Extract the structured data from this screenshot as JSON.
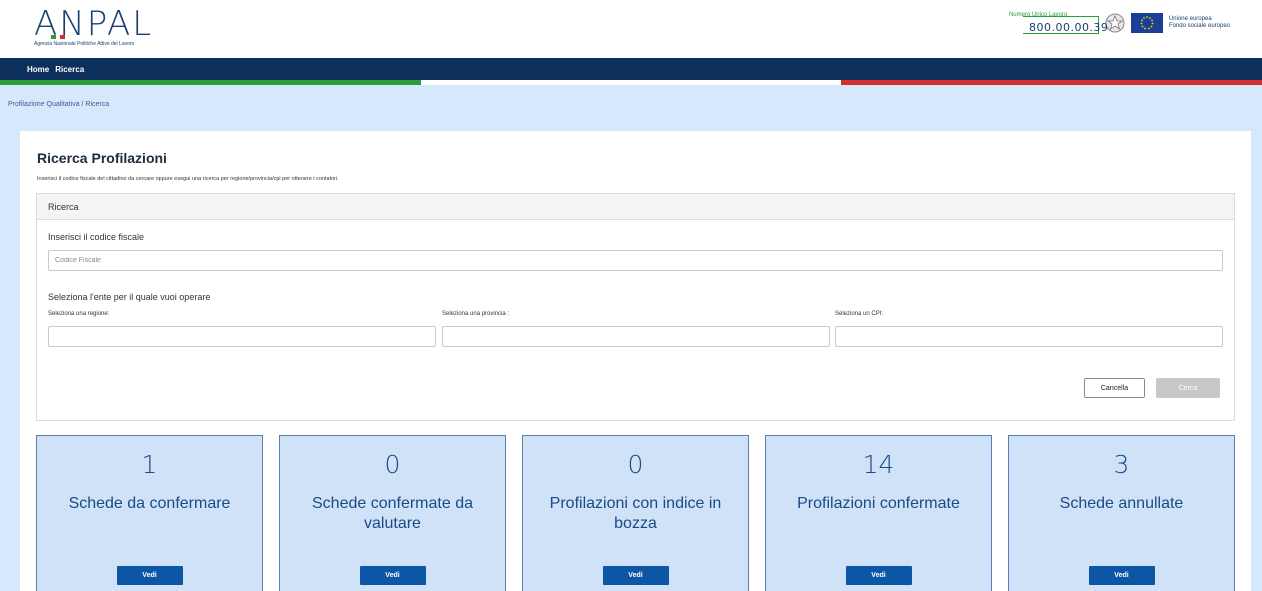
{
  "header": {
    "logo_text": "ANPAL",
    "logo_subtitle": "Agenzia Nazionale Politiche Attive del Lavoro",
    "numero_label": "Numero Unico Lavoro",
    "numero_value": "800.00.00.39",
    "eu_line1": "Unione europea",
    "eu_line2": "Fondo sociale europeo"
  },
  "nav": {
    "items": [
      "Home",
      "Ricerca"
    ]
  },
  "breadcrumb": "Profilazione Qualitativa  /  Ricerca",
  "page": {
    "title": "Ricerca Profilazioni",
    "description": "Inserisci il codice fiscale del cittadino da cercare oppure esegui una ricerca per regione/provincia/cpi per ottenere i contatori."
  },
  "search_panel": {
    "heading": "Ricerca",
    "cf_label": "Inserisci il codice fiscale",
    "cf_placeholder": "Codice Fiscale",
    "ente_label": "Seleziona l'ente per il quale vuoi operare",
    "regione_label": "Seleziona una regione:",
    "provincia_label": "Seleziona una provincia :",
    "cpi_label": "Seleziona un CPI:",
    "cancel_label": "Cancella",
    "search_label": "Cerca"
  },
  "tiles": [
    {
      "count": "1",
      "label": "Schede da confermare",
      "button": "Vedi"
    },
    {
      "count": "0",
      "label": "Schede confermate da valutare",
      "button": "Vedi"
    },
    {
      "count": "0",
      "label": "Profilazioni con indice in bozza",
      "button": "Vedi"
    },
    {
      "count": "14",
      "label": "Profilazioni confermate",
      "button": "Vedi"
    },
    {
      "count": "3",
      "label": "Schede annullate",
      "button": "Vedi"
    }
  ],
  "colors": {
    "navy": "#0d2f5c",
    "green": "#2a9c3a",
    "red": "#d32f2f",
    "tile_bg": "#cfe2f7",
    "button_blue": "#0d56a6"
  }
}
